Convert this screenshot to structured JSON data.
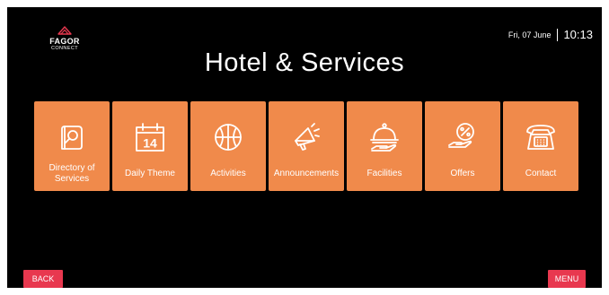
{
  "brand": {
    "name": "FAGOR",
    "sub": "CONNECT"
  },
  "header": {
    "date": "Fri, 07 June",
    "time": "10:13"
  },
  "title": "Hotel & Services",
  "tiles": [
    {
      "label": "Directory of Services",
      "icon": "directory-search-icon"
    },
    {
      "label": "Daily Theme",
      "icon": "calendar-icon",
      "icon_text": "14"
    },
    {
      "label": "Activities",
      "icon": "basketball-icon"
    },
    {
      "label": "Announcements",
      "icon": "megaphone-icon"
    },
    {
      "label": "Facilities",
      "icon": "cloche-icon"
    },
    {
      "label": "Offers",
      "icon": "percent-hand-icon"
    },
    {
      "label": "Contact",
      "icon": "telephone-icon"
    }
  ],
  "footer": {
    "back_label": "BACK",
    "menu_label": "MENU"
  },
  "colors": {
    "background": "#000000",
    "tile": "#f08a4b",
    "button": "#e8384f",
    "text": "#ffffff"
  }
}
